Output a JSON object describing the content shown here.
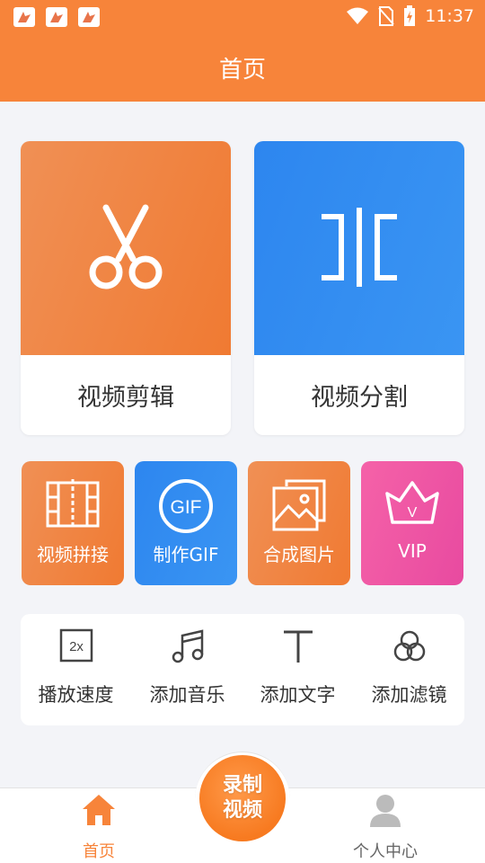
{
  "status_bar": {
    "time": "11:37",
    "notifications": [
      "notification-icon",
      "notification-icon",
      "notification-icon"
    ],
    "icons": [
      "wifi-icon",
      "no-sim-icon",
      "battery-charging-icon"
    ]
  },
  "header": {
    "title": "首页"
  },
  "feature_cards": [
    {
      "label": "视频剪辑",
      "icon": "scissors-icon",
      "color": "#f07a32"
    },
    {
      "label": "视频分割",
      "icon": "split-icon",
      "color": "#2d86ef"
    }
  ],
  "quick_actions": [
    {
      "label": "视频拼接",
      "icon": "film-splice-icon",
      "color": "#f07a32"
    },
    {
      "label": "制作GIF",
      "icon": "gif-icon",
      "badge": "GIF",
      "color": "#2d86ef"
    },
    {
      "label": "合成图片",
      "icon": "image-stack-icon",
      "color": "#f07a32"
    },
    {
      "label": "VIP",
      "icon": "crown-icon",
      "crown_letter": "V",
      "color": "#e84aa0"
    }
  ],
  "tools": [
    {
      "label": "播放速度",
      "icon": "speed-icon",
      "badge": "2x"
    },
    {
      "label": "添加音乐",
      "icon": "music-note-icon"
    },
    {
      "label": "添加文字",
      "icon": "text-icon"
    },
    {
      "label": "添加滤镜",
      "icon": "filter-icon"
    }
  ],
  "bottom_nav": {
    "home": {
      "label": "首页",
      "icon": "home-icon",
      "active": true,
      "color": "#f7843a"
    },
    "record": {
      "line1": "录制",
      "line2": "视频"
    },
    "profile": {
      "label": "个人中心",
      "icon": "user-icon",
      "active": false,
      "color": "#666666"
    }
  },
  "colors": {
    "primary": "#f7843a",
    "blue": "#2d86ef",
    "pink": "#e84aa0",
    "background": "#f3f4f8"
  }
}
